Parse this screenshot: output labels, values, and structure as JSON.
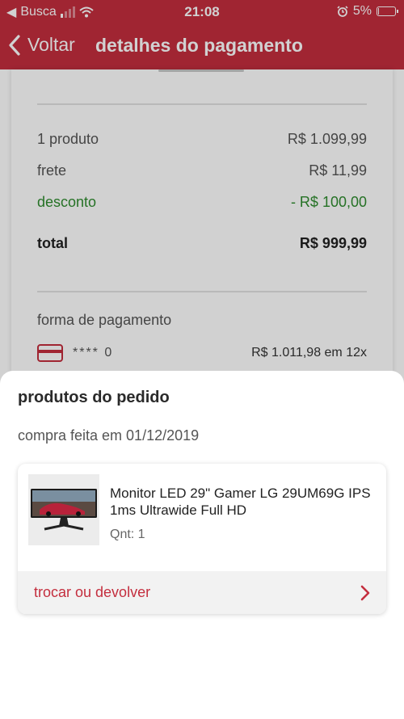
{
  "status_bar": {
    "carrier": "Busca",
    "time": "21:08",
    "battery": "5%",
    "battery_level": 0.05
  },
  "header": {
    "back_label": "Voltar",
    "title": "detalhes do pagamento"
  },
  "summary": {
    "rows": [
      {
        "label": "1 produto",
        "value": "R$ 1.099,99"
      },
      {
        "label": "frete",
        "value": "R$ 11,99"
      },
      {
        "label": "desconto",
        "value": "- R$ 100,00"
      },
      {
        "label": "total",
        "value": "R$ 999,99"
      }
    ],
    "payment_title": "forma de pagamento",
    "payment_masked": "**** 0",
    "payment_amount": "R$ 1.011,98 em 12x"
  },
  "sheet": {
    "title": "produtos do pedido",
    "date": "compra feita em 01/12/2019",
    "product": {
      "name": "Monitor LED 29\" Gamer  LG 29UM69G IPS 1ms Ultrawide Full HD",
      "qty": "Qnt: 1"
    },
    "action_label": "trocar ou devolver"
  },
  "colors": {
    "brand": "#c42e3e",
    "discount": "#2e8b2e"
  }
}
